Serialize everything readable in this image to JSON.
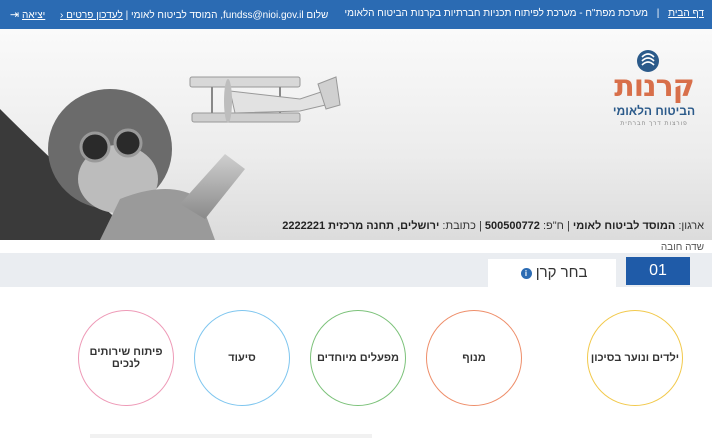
{
  "topbar": {
    "home_link": "דף הבית",
    "system_name": "מערכת מפת\"ח - מערכת לפיתוח תכניות חברתיות בקרנות הביטוח הלאומי",
    "greeting": "שלום fundss@nioi.gov.il, המוסד לביטוח לאומי |",
    "profile_link": "לעדכון פרטים",
    "logout_link": "יציאה"
  },
  "logo": {
    "title": "קרנות",
    "subtitle": "הביטוח הלאומי",
    "tagline": "פורצות דרך חברתית"
  },
  "org": {
    "org_label": "ארגון:",
    "org_name": "המוסד לביטוח לאומי",
    "id_label": "ח\"פ:",
    "id_value": "500500772",
    "address_label": "כתובת:",
    "address_value": "ירושלים, תחנה מרכזית 2222221"
  },
  "required_note": "שדה חובה",
  "step": {
    "number": "01",
    "title": "בחר קרן"
  },
  "funds": [
    {
      "label": "ילדים ונוער בסיכון",
      "color": "#f2c94c"
    },
    {
      "label": "מנוף",
      "color": "#ee8e6a"
    },
    {
      "label": "מפעלים מיוחדים",
      "color": "#7cc27a"
    },
    {
      "label": "סיעוד",
      "color": "#7fc6ef"
    },
    {
      "label": "פיתוח שירותים לנכים",
      "color": "#ee9ab7"
    }
  ],
  "icons": {
    "info": "info-icon",
    "exit": "exit-icon",
    "chevron": "chevron-left-icon"
  }
}
